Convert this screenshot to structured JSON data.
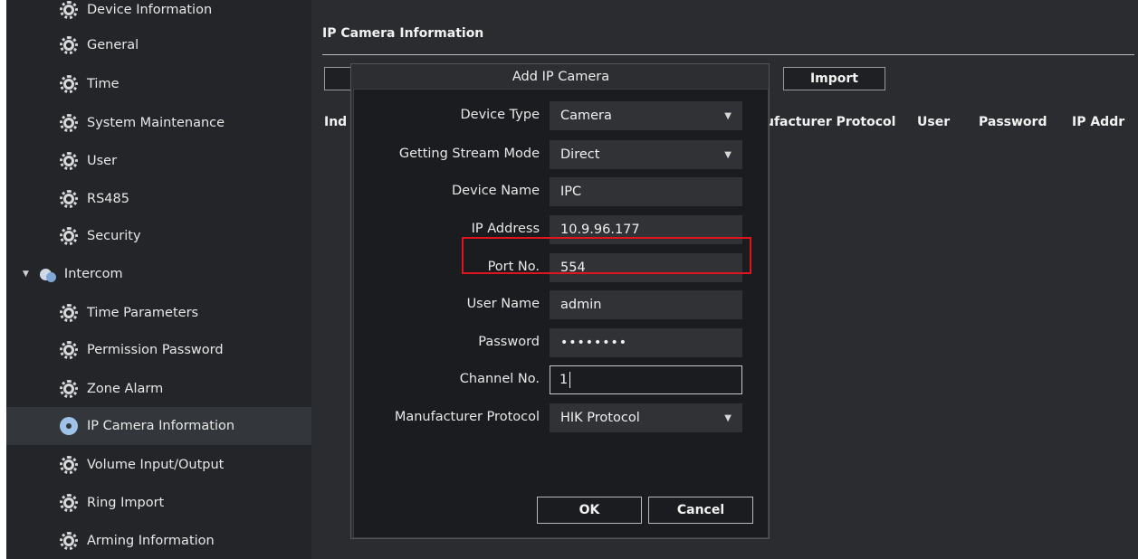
{
  "sidebar": {
    "items": [
      {
        "label": "Device Information",
        "active": false
      },
      {
        "label": "General",
        "active": false
      },
      {
        "label": "Time",
        "active": false
      },
      {
        "label": "System Maintenance",
        "active": false
      },
      {
        "label": "User",
        "active": false
      },
      {
        "label": "RS485",
        "active": false
      },
      {
        "label": "Security",
        "active": false
      },
      {
        "label": "Intercom",
        "active": false,
        "expanded": true
      },
      {
        "label": "Time Parameters",
        "active": false
      },
      {
        "label": "Permission Password",
        "active": false
      },
      {
        "label": "Zone Alarm",
        "active": false
      },
      {
        "label": "IP Camera Information",
        "active": true
      },
      {
        "label": "Volume Input/Output",
        "active": false
      },
      {
        "label": "Ring Import",
        "active": false
      },
      {
        "label": "Arming Information",
        "active": false
      }
    ]
  },
  "main": {
    "title": "IP Camera Information",
    "import_label": "Import",
    "columns": [
      "Ind",
      "ufacturer Protocol",
      "User",
      "Password",
      "IP Addr"
    ]
  },
  "dialog": {
    "title": "Add IP Camera",
    "fields": {
      "device_type": {
        "label": "Device Type",
        "value": "Camera"
      },
      "stream_mode": {
        "label": "Getting Stream Mode",
        "value": "Direct"
      },
      "device_name": {
        "label": "Device Name",
        "value": "IPC"
      },
      "ip_address": {
        "label": "IP Address",
        "value": "10.9.96.177"
      },
      "port_no": {
        "label": "Port No.",
        "value": "554"
      },
      "user_name": {
        "label": "User Name",
        "value": "admin"
      },
      "password": {
        "label": "Password",
        "value": "••••••••"
      },
      "channel_no": {
        "label": "Channel No.",
        "value": "1"
      },
      "protocol": {
        "label": "Manufacturer Protocol",
        "value": "HIK Protocol"
      }
    },
    "ok_label": "OK",
    "cancel_label": "Cancel"
  },
  "colors": {
    "sidebar_bg": "#232528",
    "active_item_bg": "#33363a",
    "main_bg": "#2a2c30",
    "highlight": "#e0141b"
  }
}
